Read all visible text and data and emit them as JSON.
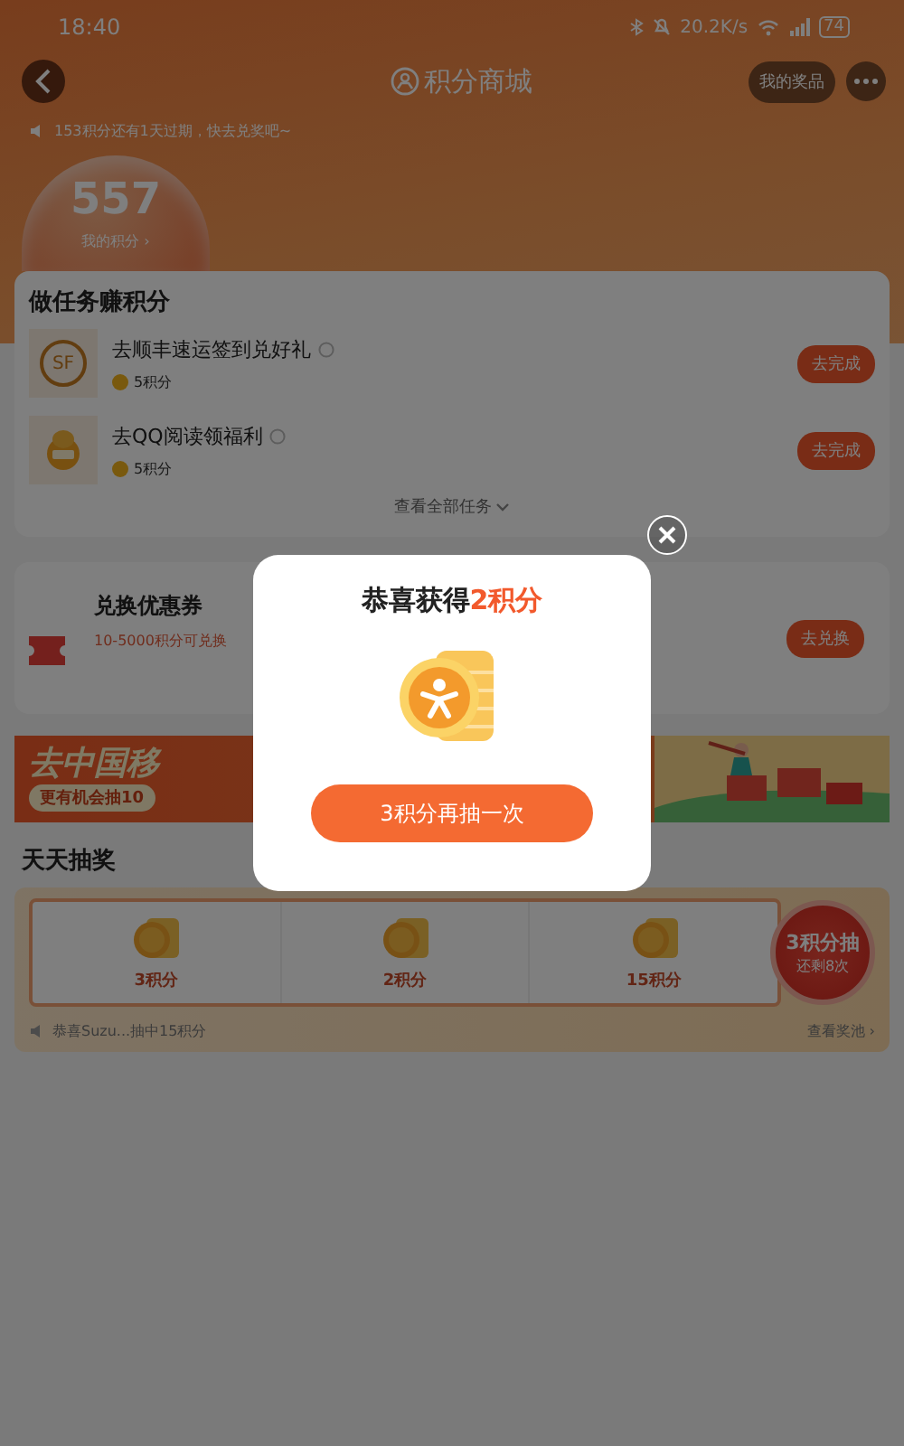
{
  "status_bar": {
    "time": "18:40",
    "net_speed": "20.2K/s",
    "battery": "74"
  },
  "header": {
    "title": "积分商城",
    "my_prizes": "我的奖品"
  },
  "notice": "153积分还有1天过期，快去兑奖吧~",
  "points": {
    "value": "557",
    "label": "我的积分 ›"
  },
  "tasks": {
    "title": "做任务赚积分",
    "more": "查看全部任务",
    "items": [
      {
        "kind": "logo",
        "logo_text": "SF",
        "name": "去顺丰速运签到兑好礼",
        "reward": "5积分",
        "action": "去完成"
      },
      {
        "kind": "mascot",
        "name": "去QQ阅读领福利",
        "reward": "5积分",
        "action": "去完成"
      }
    ]
  },
  "coupon": {
    "title": "兑换优惠券",
    "subtitle": "10-5000积分可兑换",
    "action": "去兑换"
  },
  "banner": {
    "headline": "去中国移",
    "subline": "更有机会抽10"
  },
  "lottery": {
    "title": "天天抽奖",
    "prizes": [
      {
        "label": "3积分"
      },
      {
        "label": "2积分"
      },
      {
        "label": "15积分"
      }
    ],
    "draw_label": "3积分抽",
    "remaining": "还剩8次",
    "winner": "恭喜Suzu...抽中15积分",
    "pool_link": "查看奖池 ›"
  },
  "dialog": {
    "title": "恭喜获得",
    "highlight": "2积分",
    "button": "3积分再抽一次"
  }
}
